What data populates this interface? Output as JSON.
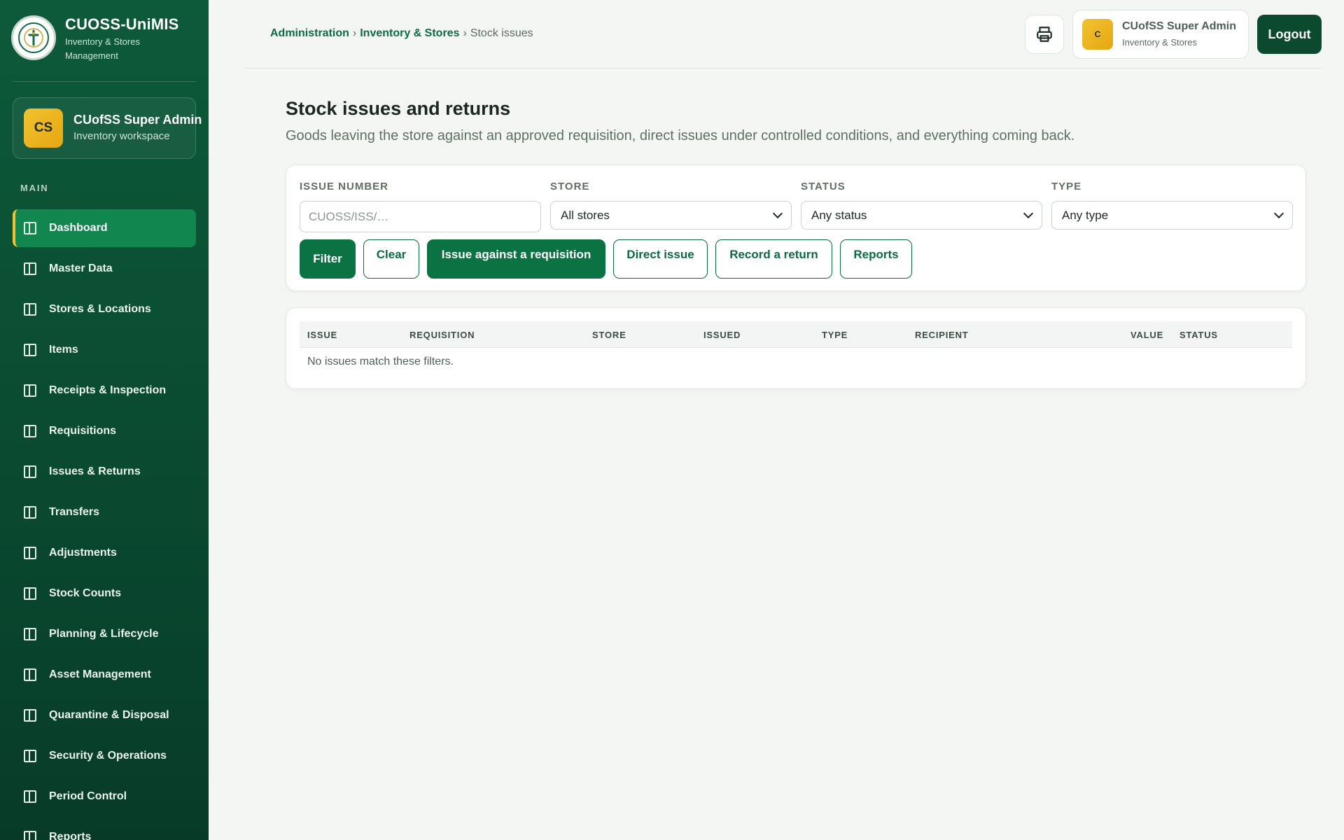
{
  "brand": {
    "title": "CUOSS-UniMIS",
    "subtitle": "Inventory & Stores Management"
  },
  "sidebar_user": {
    "initials": "CS",
    "name": "CUofSS Super Admin",
    "role": "Inventory workspace"
  },
  "sidebar": {
    "section_label": "MAIN",
    "items": [
      {
        "label": "Dashboard"
      },
      {
        "label": "Master Data"
      },
      {
        "label": "Stores & Locations"
      },
      {
        "label": "Items"
      },
      {
        "label": "Receipts & Inspection"
      },
      {
        "label": "Requisitions"
      },
      {
        "label": "Issues & Returns"
      },
      {
        "label": "Transfers"
      },
      {
        "label": "Adjustments"
      },
      {
        "label": "Stock Counts"
      },
      {
        "label": "Planning & Lifecycle"
      },
      {
        "label": "Asset Management"
      },
      {
        "label": "Quarantine & Disposal"
      },
      {
        "label": "Security & Operations"
      },
      {
        "label": "Period Control"
      },
      {
        "label": "Reports"
      }
    ]
  },
  "breadcrumb": {
    "level1": "Administration",
    "level2": "Inventory & Stores",
    "current": "Stock issues",
    "separator": "›"
  },
  "header": {
    "print_icon": "printer-icon",
    "profile": {
      "initial": "C",
      "name": "CUofSS Super Admin",
      "role": "Inventory & Stores"
    },
    "logout_label": "Logout"
  },
  "page": {
    "title": "Stock issues and returns",
    "description": "Goods leaving the store against an approved requisition, direct issues under controlled conditions, and everything coming back."
  },
  "filters": {
    "issue_number": {
      "label": "ISSUE NUMBER",
      "placeholder": "CUOSS/ISS/…",
      "value": ""
    },
    "store": {
      "label": "STORE",
      "value": "All stores"
    },
    "status": {
      "label": "STATUS",
      "value": "Any status"
    },
    "type": {
      "label": "TYPE",
      "value": "Any type"
    }
  },
  "actions": {
    "filter": "Filter",
    "clear": "Clear",
    "issue_requisition": "Issue against a requisition",
    "direct_issue": "Direct issue",
    "record_return": "Record a return",
    "reports": "Reports"
  },
  "table": {
    "columns": [
      "ISSUE",
      "REQUISITION",
      "STORE",
      "ISSUED",
      "TYPE",
      "RECIPIENT",
      "VALUE",
      "STATUS"
    ],
    "rows": [],
    "empty_message": "No issues match these filters."
  },
  "colors": {
    "sidebar": "#0d5a3a",
    "accent": "#0b7343",
    "active_item": "#11864f",
    "highlight": "#f2c230"
  }
}
